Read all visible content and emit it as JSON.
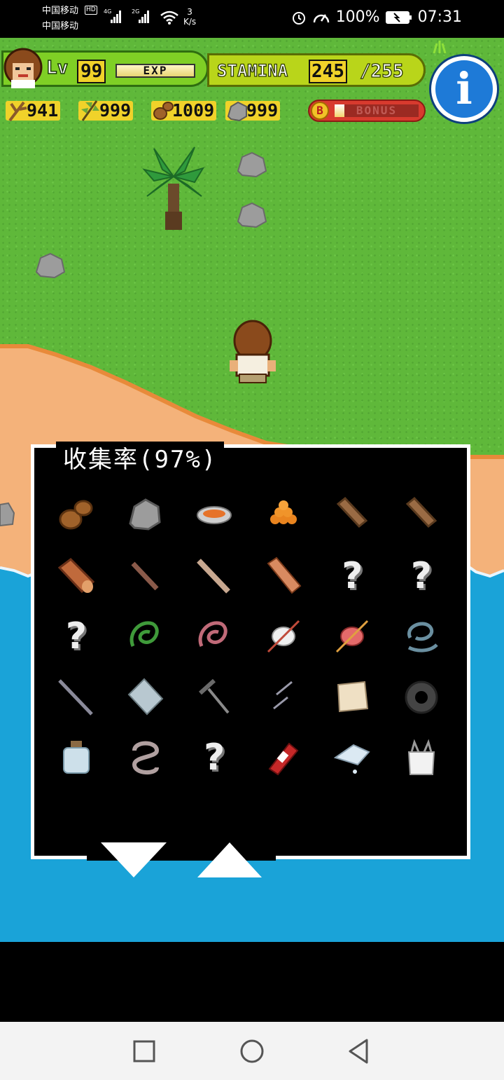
{
  "status_bar": {
    "carrier1": "中国移动",
    "carrier2": "中国移动",
    "hd": "HD",
    "net1": "4G",
    "net2": "2G",
    "speed_value": "3",
    "speed_unit": "K/s",
    "battery": "100%",
    "time": "07:31"
  },
  "hud": {
    "level_label": "Lv",
    "level": "99",
    "exp_label": "EXP",
    "exp_fill": 1.0,
    "stamina_label": "STAMINA",
    "stamina": "245",
    "stamina_max": "/255",
    "resources": [
      {
        "icon": "branch-icon",
        "value": "941"
      },
      {
        "icon": "leaf-icon",
        "value": "999"
      },
      {
        "icon": "nuts-icon",
        "value": "1009"
      },
      {
        "icon": "stone-icon",
        "value": "999"
      }
    ],
    "bonus_coin": "B",
    "bonus_label": "BONUS",
    "bonus_fill": 0.12,
    "info_label": "i"
  },
  "collection": {
    "title": "收集率(97%)",
    "rows": [
      [
        "nuts-icon",
        "stone-icon",
        "bowl-icon",
        "berries-icon",
        "log-icon",
        "log-icon"
      ],
      [
        "log-big-icon",
        "stick-icon",
        "plank-icon",
        "board-icon",
        "unknown",
        "unknown"
      ],
      [
        "unknown",
        "green-rope-icon",
        "pink-rope-icon",
        "white-yarn-icon",
        "red-yarn-icon",
        "blue-rope-icon"
      ],
      [
        "rod-icon",
        "glass-shard-icon",
        "hammer-icon",
        "nails-icon",
        "cloth-icon",
        "tire-icon"
      ],
      [
        "bottle-icon",
        "chain-icon",
        "unknown",
        "can-icon",
        "plastic-icon",
        "bag-icon"
      ]
    ],
    "unknown_glyph": "?"
  },
  "colors": {
    "grass": "#5fb83a",
    "sand": "#f4b27a",
    "sea": "#1aa3d8",
    "hud_green": "#7fcf25",
    "hud_yellow": "#f0d22a",
    "info_blue": "#1e7ad7"
  }
}
